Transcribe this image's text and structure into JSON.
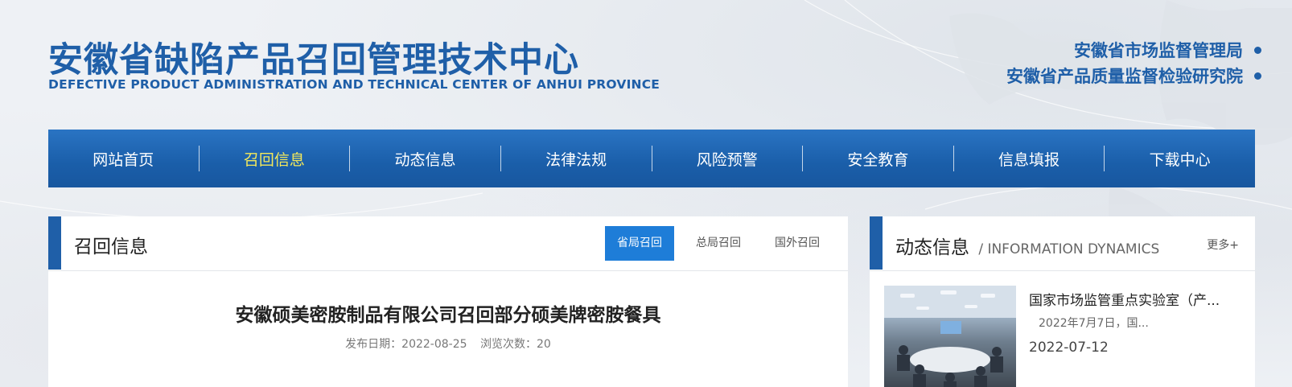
{
  "header": {
    "title": "安徽省缺陷产品召回管理技术中心",
    "subtitle": "DEFECTIVE PRODUCT ADMINISTRATION AND TECHNICAL CENTER OF ANHUI PROVINCE",
    "orgs": [
      "安徽省市场监督管理局",
      "安徽省产品质量监督检验研究院"
    ]
  },
  "nav": {
    "items": [
      "网站首页",
      "召回信息",
      "动态信息",
      "法律法规",
      "风险预警",
      "安全教育",
      "信息填报",
      "下载中心"
    ],
    "active_index": 1
  },
  "main": {
    "title": "召回信息",
    "tabs": [
      "省局召回",
      "总局召回",
      "国外召回"
    ],
    "active_tab": 0,
    "article": {
      "title": "安徽硕美密胺制品有限公司召回部分硕美牌密胺餐具",
      "date_label": "发布日期：2022-08-25",
      "views_label": "浏览次数：20"
    }
  },
  "side": {
    "title": "动态信息",
    "title_en": "/ INFORMATION DYNAMICS",
    "more": "更多+",
    "news": {
      "title": "国家市场监管重点实验室（产...",
      "desc": "2022年7月7日，国...",
      "date": "2022-07-12"
    }
  },
  "colors": {
    "brand": "#1f5fa8",
    "nav_active": "#f3e85b",
    "tab_active": "#1e7dd8"
  }
}
